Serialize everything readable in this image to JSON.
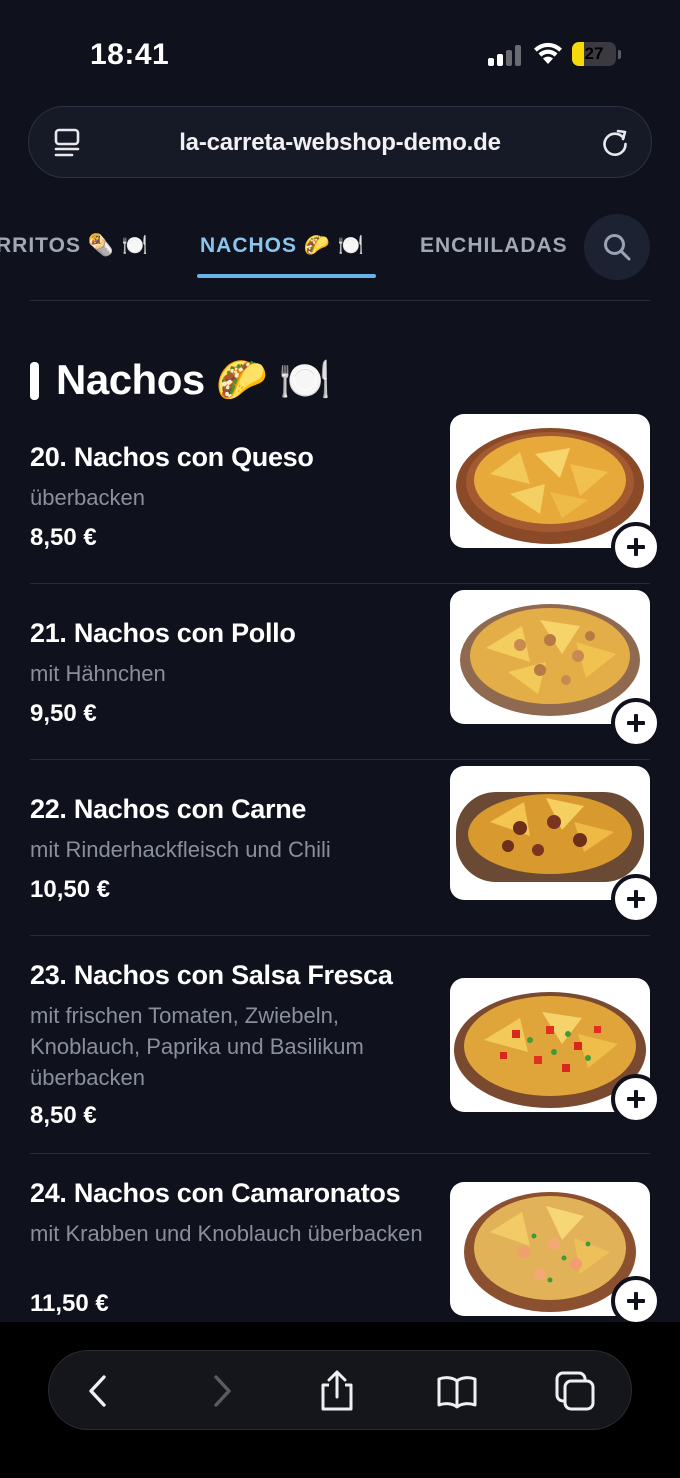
{
  "status": {
    "time": "18:41",
    "battery": "27",
    "battery_level": 0.27
  },
  "browser": {
    "url": "la-carreta-webshop-demo.de"
  },
  "tabs": [
    {
      "label": "RRITOS 🌯 🍽️",
      "active": false
    },
    {
      "label": "NACHOS 🌮 🍽️",
      "active": true
    },
    {
      "label": "ENCHILADAS",
      "active": false
    }
  ],
  "section": {
    "title": "Nachos 🌮 🍽️"
  },
  "items": [
    {
      "name": "20. Nachos con Queso",
      "desc": "überbacken",
      "price": "8,50 €",
      "topping": "cheese"
    },
    {
      "name": "21. Nachos con Pollo",
      "desc": "mit Hähnchen",
      "price": "9,50 €",
      "topping": "chicken"
    },
    {
      "name": "22. Nachos con Carne",
      "desc": "mit Rinderhackfleisch und Chili",
      "price": "10,50 €",
      "topping": "beef"
    },
    {
      "name": "23. Nachos con Salsa Fresca",
      "desc": "mit frischen Tomaten, Zwiebeln, Knoblauch, Paprika und Basilikum überbacken",
      "price": "8,50 €",
      "topping": "salsa"
    },
    {
      "name": "24. Nachos con Camaronatos",
      "desc": "mit Krabben und Knoblauch überbacken",
      "price": "11,50 €",
      "topping": "shrimp"
    }
  ],
  "colors": {
    "background": "#0f111c",
    "accent": "#6ab2e8",
    "muted_text": "#8a8f9d"
  },
  "toolbar_icons": [
    "back-icon",
    "forward-icon",
    "share-icon",
    "bookmarks-icon",
    "tabs-icon"
  ]
}
